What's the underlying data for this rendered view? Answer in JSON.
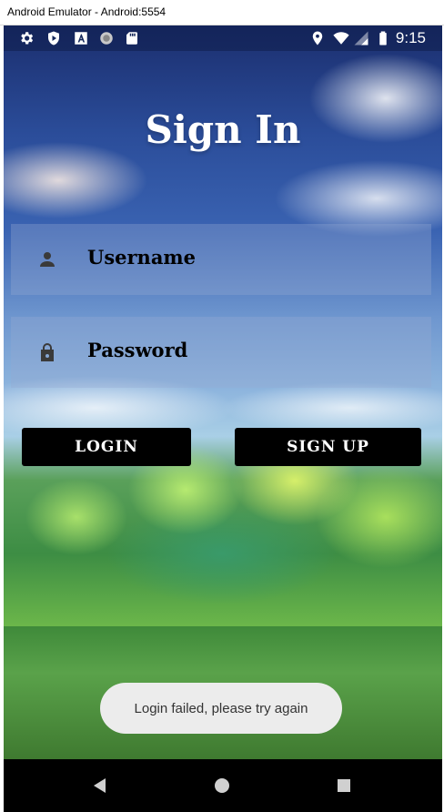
{
  "window": {
    "title": "Android Emulator - Android:5554"
  },
  "status_bar": {
    "left_icons": [
      "gear-icon",
      "shield-icon",
      "a-icon",
      "circle-icon",
      "sd-card-icon"
    ],
    "right_icons": [
      "location-icon",
      "wifi-icon",
      "signal-icon",
      "battery-icon"
    ],
    "time": "9:15"
  },
  "screen": {
    "title": "Sign In",
    "username": {
      "placeholder": "Username",
      "icon": "person-icon"
    },
    "password": {
      "placeholder": "Password",
      "icon": "lock-icon"
    },
    "login_button": "LOGIN",
    "signup_button": "SIGN UP",
    "toast": "Login failed, please try again"
  },
  "nav_bar": {
    "buttons": [
      "back-icon",
      "home-icon",
      "recents-icon"
    ]
  }
}
